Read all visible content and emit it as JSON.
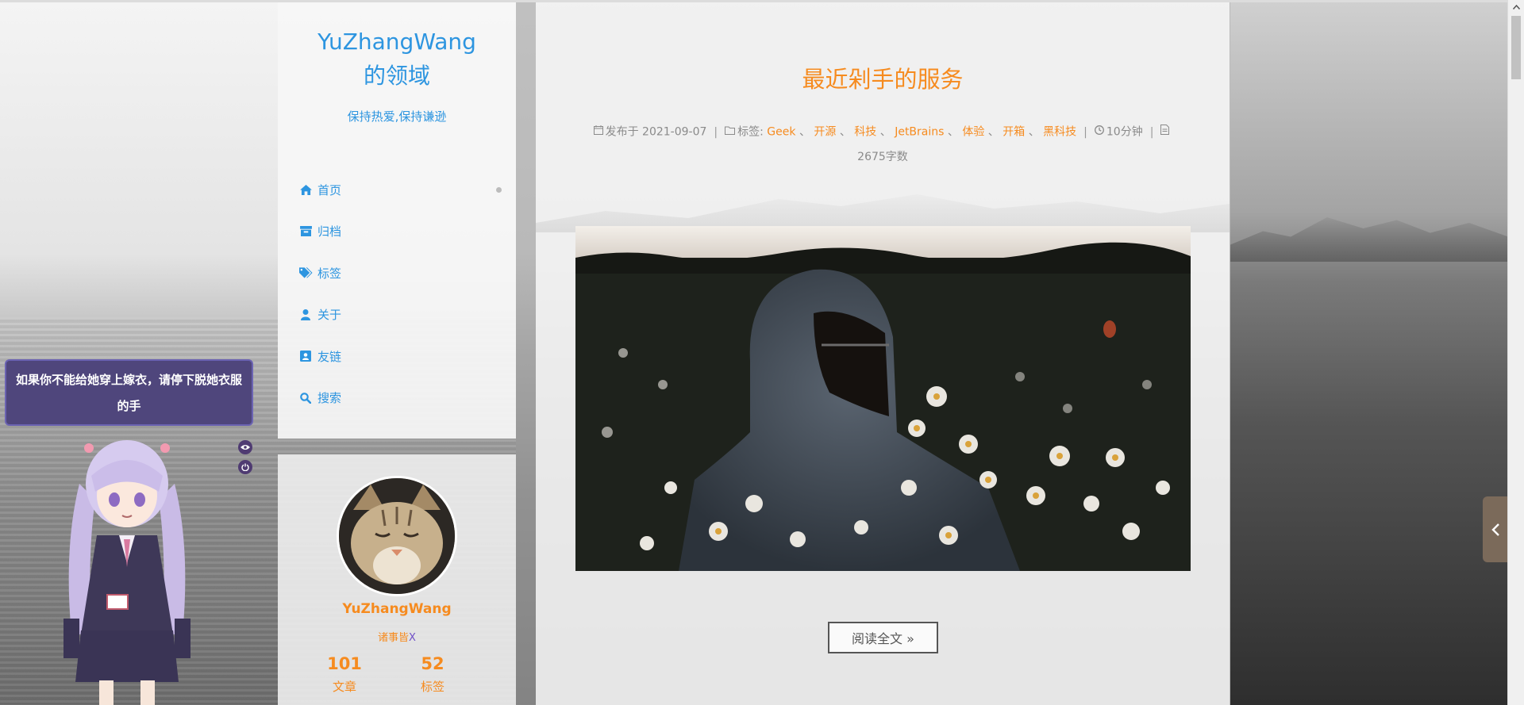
{
  "site": {
    "title_line1": "YuZhangWang",
    "title_line2": "的领域",
    "subtitle": "保持热爱,保持谦逊"
  },
  "menu": {
    "items": [
      {
        "label": "首页",
        "icon": "home-icon"
      },
      {
        "label": "归档",
        "icon": "archive-icon"
      },
      {
        "label": "标签",
        "icon": "tags-icon"
      },
      {
        "label": "关于",
        "icon": "user-icon"
      },
      {
        "label": "友链",
        "icon": "contact-book-icon"
      },
      {
        "label": "搜索",
        "icon": "search-icon"
      }
    ]
  },
  "author": {
    "name": "YuZhangWang",
    "desc_main": "诸事皆",
    "desc_tail": "X",
    "stats": [
      {
        "num": "101",
        "label": "文章"
      },
      {
        "num": "52",
        "label": "标签"
      }
    ]
  },
  "post": {
    "title": "最近剁手的服务",
    "published_label": "发布于",
    "published_date": "2021-09-07",
    "tags_label": "标签:",
    "tags": [
      "Geek",
      "开源",
      "科技",
      "JetBrains",
      "体验",
      "开箱",
      "黑科技"
    ],
    "tag_separator": "、",
    "read_time": "10分钟",
    "word_count": "2675字数",
    "read_more": "阅读全文 »"
  },
  "mascot": {
    "speech": "如果你不能给她穿上嫁衣，请停下脱她衣服的手"
  },
  "colors": {
    "accent_blue": "#2d95e0",
    "accent_orange": "#f68b1f",
    "speech_bg": "#4f467c"
  }
}
